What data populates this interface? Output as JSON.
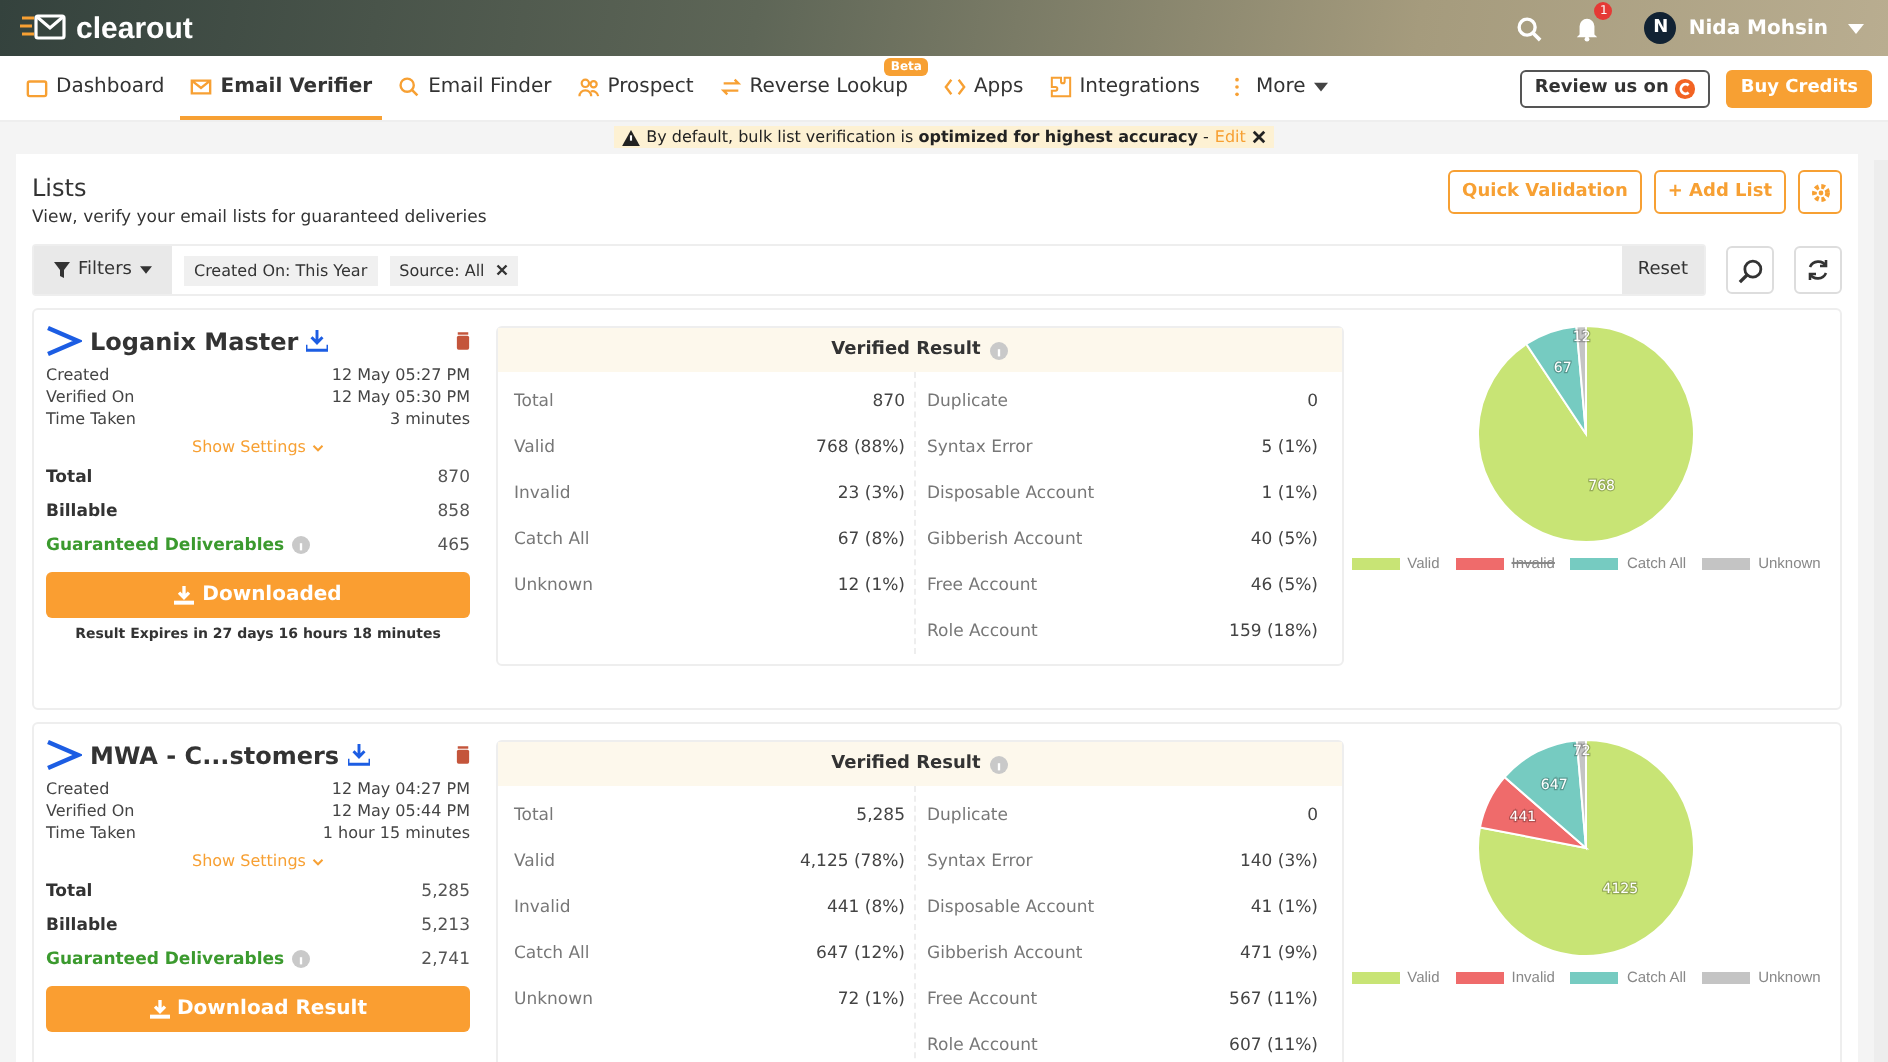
{
  "header": {
    "logo": "clearout",
    "notification_count": "1",
    "user": {
      "initial": "N",
      "name": "Nida Mohsin"
    }
  },
  "nav": {
    "tabs": [
      {
        "label": "Dashboard",
        "selected": false
      },
      {
        "label": "Email Verifier",
        "selected": true
      },
      {
        "label": "Email Finder",
        "selected": false
      },
      {
        "label": "Prospect",
        "selected": false
      },
      {
        "label": "Reverse Lookup",
        "selected": false,
        "badge": "Beta"
      },
      {
        "label": "Apps",
        "selected": false
      },
      {
        "label": "Integrations",
        "selected": false
      },
      {
        "label": "More",
        "selected": false
      }
    ],
    "review_button": "Review us on",
    "buy_button": "Buy Credits"
  },
  "notice": {
    "text": "By default, bulk list verification is **optimized for highest accuracy** -",
    "link": "Edit"
  },
  "lists": {
    "title": "Lists",
    "subtitle": "View, verify your email lists for guaranteed deliveries",
    "quick_validation": "Quick Validation",
    "add_list": "+ Add List",
    "filters": {
      "label": "Filters",
      "chips": [
        {
          "text": "Created On: This Year",
          "removable": false
        },
        {
          "text": "Source: All",
          "removable": true
        }
      ],
      "reset": "Reset"
    }
  },
  "cards": [
    {
      "name": "Loganix Master",
      "details": [
        {
          "label": "Created",
          "value": "12 May 05:27 PM"
        },
        {
          "label": "Verified On",
          "value": "12 May 05:30 PM"
        },
        {
          "label": "Time Taken",
          "value": "3 minutes"
        }
      ],
      "show_settings": "Show Settings",
      "totals": [
        {
          "label": "Total",
          "value": "870"
        },
        {
          "label": "Billable",
          "value": "858"
        }
      ],
      "guaranteed": {
        "label": "Guaranteed Deliverables",
        "value": "465"
      },
      "button": "Downloaded",
      "expires": "Result Expires in 27 days 16 hours 18 minutes",
      "verified_title": "Verified Result",
      "left": [
        {
          "label": "Total",
          "value": "870"
        },
        {
          "label": "Valid",
          "value": "768 (88%)"
        },
        {
          "label": "Invalid",
          "value": "23 (3%)"
        },
        {
          "label": "Catch All",
          "value": "67 (8%)"
        },
        {
          "label": "Unknown",
          "value": "12 (1%)"
        }
      ],
      "right": [
        {
          "label": "Duplicate",
          "value": "0"
        },
        {
          "label": "Syntax Error",
          "value": "5 (1%)"
        },
        {
          "label": "Disposable Account",
          "value": "1 (1%)"
        },
        {
          "label": "Gibberish Account",
          "value": "40 (5%)"
        },
        {
          "label": "Free Account",
          "value": "46 (5%)"
        },
        {
          "label": "Role Account",
          "value": "159 (18%)"
        }
      ],
      "legend": [
        {
          "color": "#c8e475",
          "hidden": false
        },
        {
          "color": "#ef6b6b",
          "hidden": true
        },
        {
          "color": "#76cbc1",
          "hidden": false
        },
        {
          "color": "#c4c4c4",
          "hidden": false
        }
      ],
      "chart_data": {
        "type": "pie",
        "categories": [
          "Valid",
          "Invalid",
          "Catch All",
          "Unknown"
        ],
        "values": [
          768,
          null,
          67,
          12
        ],
        "data_labels": true
      }
    },
    {
      "name": "MWA - C...stomers",
      "details": [
        {
          "label": "Created",
          "value": "12 May 04:27 PM"
        },
        {
          "label": "Verified On",
          "value": "12 May 05:44 PM"
        },
        {
          "label": "Time Taken",
          "value": "1 hour 15 minutes"
        }
      ],
      "show_settings": "Show Settings",
      "totals": [
        {
          "label": "Total",
          "value": "5,285"
        },
        {
          "label": "Billable",
          "value": "5,213"
        }
      ],
      "guaranteed": {
        "label": "Guaranteed Deliverables",
        "value": "2,741"
      },
      "button": "Download Result",
      "verified_title": "Verified Result",
      "left": [
        {
          "label": "Total",
          "value": "5,285"
        },
        {
          "label": "Valid",
          "value": "4,125 (78%)"
        },
        {
          "label": "Invalid",
          "value": "441 (8%)"
        },
        {
          "label": "Catch All",
          "value": "647 (12%)"
        },
        {
          "label": "Unknown",
          "value": "72 (1%)"
        }
      ],
      "right": [
        {
          "label": "Duplicate",
          "value": "0"
        },
        {
          "label": "Syntax Error",
          "value": "140 (3%)"
        },
        {
          "label": "Disposable Account",
          "value": "41 (1%)"
        },
        {
          "label": "Gibberish Account",
          "value": "471 (9%)"
        },
        {
          "label": "Free Account",
          "value": "567 (11%)"
        },
        {
          "label": "Role Account",
          "value": "607 (11%)"
        }
      ],
      "legend": [
        {
          "color": "#c8e475",
          "hidden": false
        },
        {
          "color": "#ef6b6b",
          "hidden": false
        },
        {
          "color": "#76cbc1",
          "hidden": false
        },
        {
          "color": "#c4c4c4",
          "hidden": false
        }
      ],
      "chart_data": {
        "type": "pie",
        "categories": [
          "Valid",
          "Invalid",
          "Catch All",
          "Unknown"
        ],
        "values": [
          4125,
          441,
          647,
          72
        ],
        "data_labels": true
      }
    }
  ]
}
